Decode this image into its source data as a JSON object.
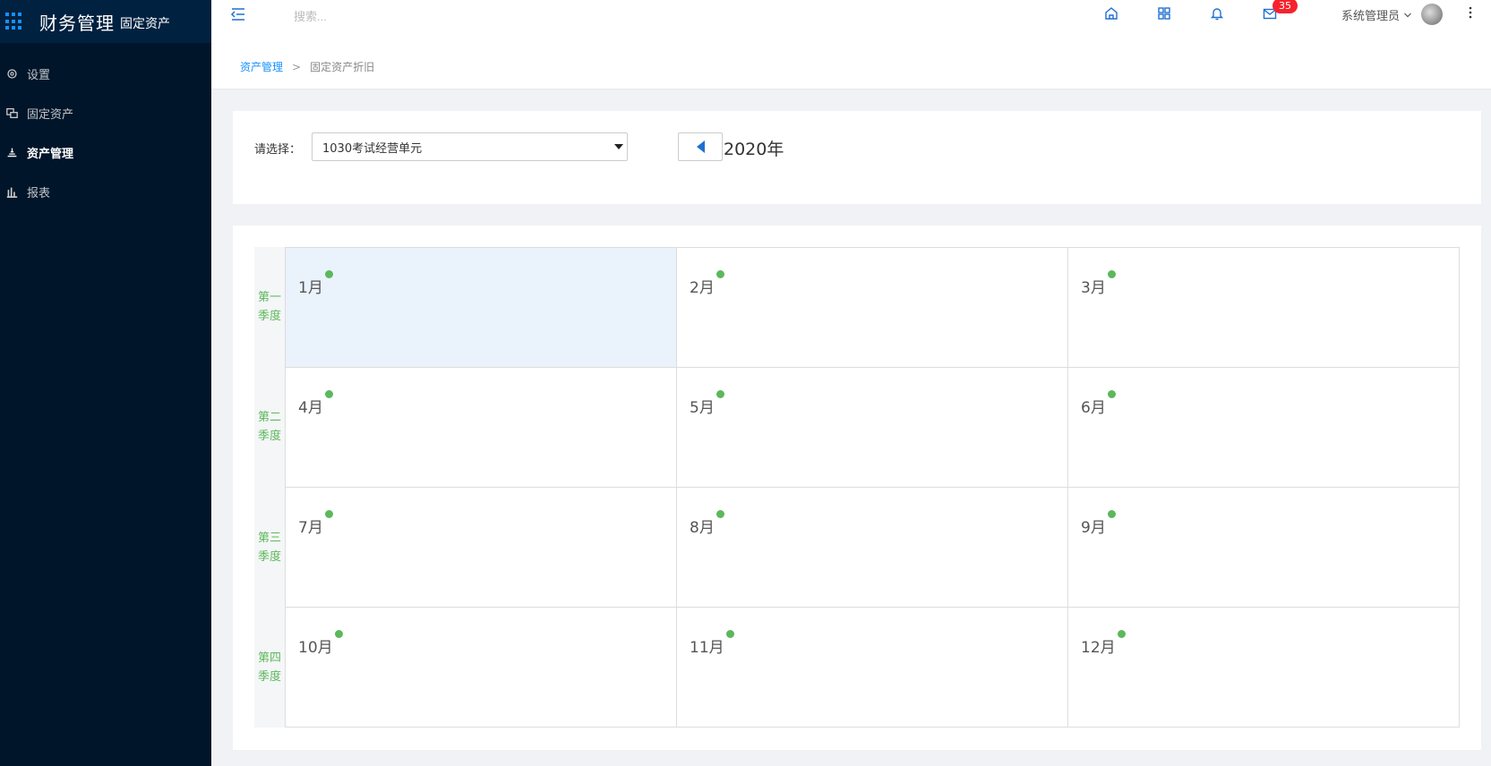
{
  "app": {
    "title": "财务管理",
    "subtitle": "固定资产"
  },
  "sidebar": {
    "items": [
      {
        "label": "设置",
        "icon": "gear-icon",
        "active": false
      },
      {
        "label": "固定资产",
        "icon": "assets-icon",
        "active": false
      },
      {
        "label": "资产管理",
        "icon": "asset-manage-icon",
        "active": true
      },
      {
        "label": "报表",
        "icon": "bar-chart-icon",
        "active": false
      }
    ]
  },
  "header": {
    "search_placeholder": "搜索...",
    "mail_badge": "35",
    "user_name": "系统管理员"
  },
  "breadcrumb": {
    "parent": "资产管理",
    "separator": ">",
    "current": "固定资产折旧"
  },
  "filter": {
    "label": "请选择：",
    "selected_unit": "1030考试经营单元",
    "year": "2020年"
  },
  "calendar": {
    "quarters": [
      "第一季度",
      "第二季度",
      "第三季度",
      "第四季度"
    ],
    "months": [
      "1月",
      "2月",
      "3月",
      "4月",
      "5月",
      "6月",
      "7月",
      "8月",
      "9月",
      "10月",
      "11月",
      "12月"
    ],
    "selected_month": "1月",
    "status_color": "#5cb85c"
  },
  "colors": {
    "sidebar_bg": "#001529",
    "accent": "#1890ff",
    "badge": "#f5222d",
    "quarter_text": "#5cb85c"
  }
}
